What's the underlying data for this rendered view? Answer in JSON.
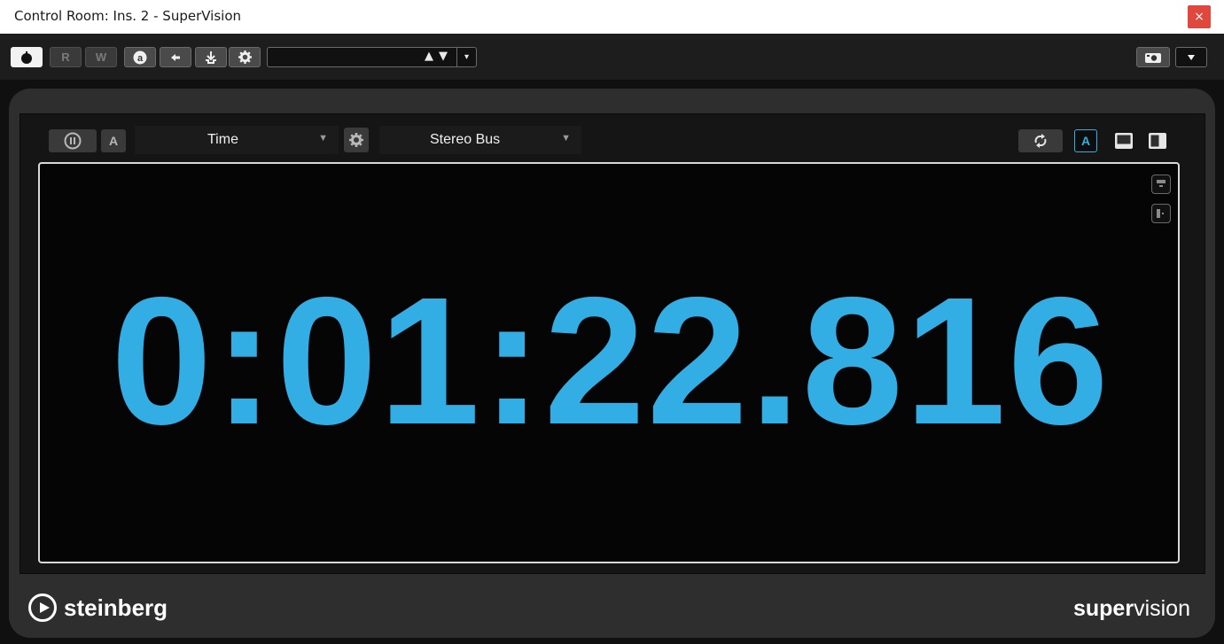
{
  "window": {
    "title": "Control Room: Ins. 2 - SuperVision",
    "close_glyph": "×"
  },
  "host_toolbar": {
    "read_label": "R",
    "write_label": "W",
    "preset_name": "",
    "preset_arrows": "▲▼",
    "preset_dropdown": "▾"
  },
  "plugin": {
    "pause_glyph": "Ⅱ",
    "a_label": "A",
    "module_select": "Time",
    "channel_select": "Stereo Bus",
    "right_a_label": "A",
    "time_value": "0:01:22.816",
    "accent_color": "#33aee4"
  },
  "footer": {
    "brand_left": "steinberg",
    "brand_right_bold": "super",
    "brand_right_light": "vision"
  }
}
